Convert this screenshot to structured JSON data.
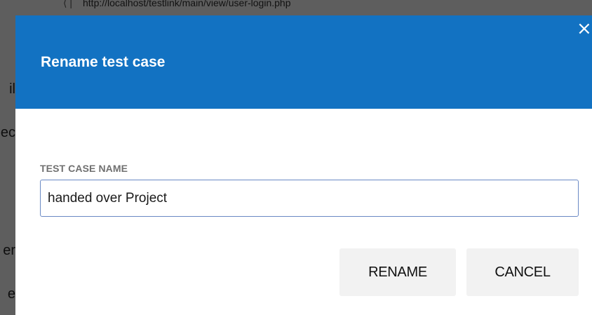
{
  "background": {
    "url_text": "http://localhost/testlink/main/view/user-login.php",
    "fragments": [
      "il",
      "ec",
      "er",
      "e"
    ]
  },
  "dialog": {
    "title": "Rename test case",
    "close_glyph": "×",
    "field_label": "TEST CASE NAME",
    "field_value": "handed over Project",
    "rename_label": "RENAME",
    "cancel_label": "CANCEL"
  },
  "colors": {
    "header": "#1272c2",
    "overlay": "#5e5e5e",
    "button_bg": "#f2f2f2",
    "input_border": "#6a89c4"
  }
}
